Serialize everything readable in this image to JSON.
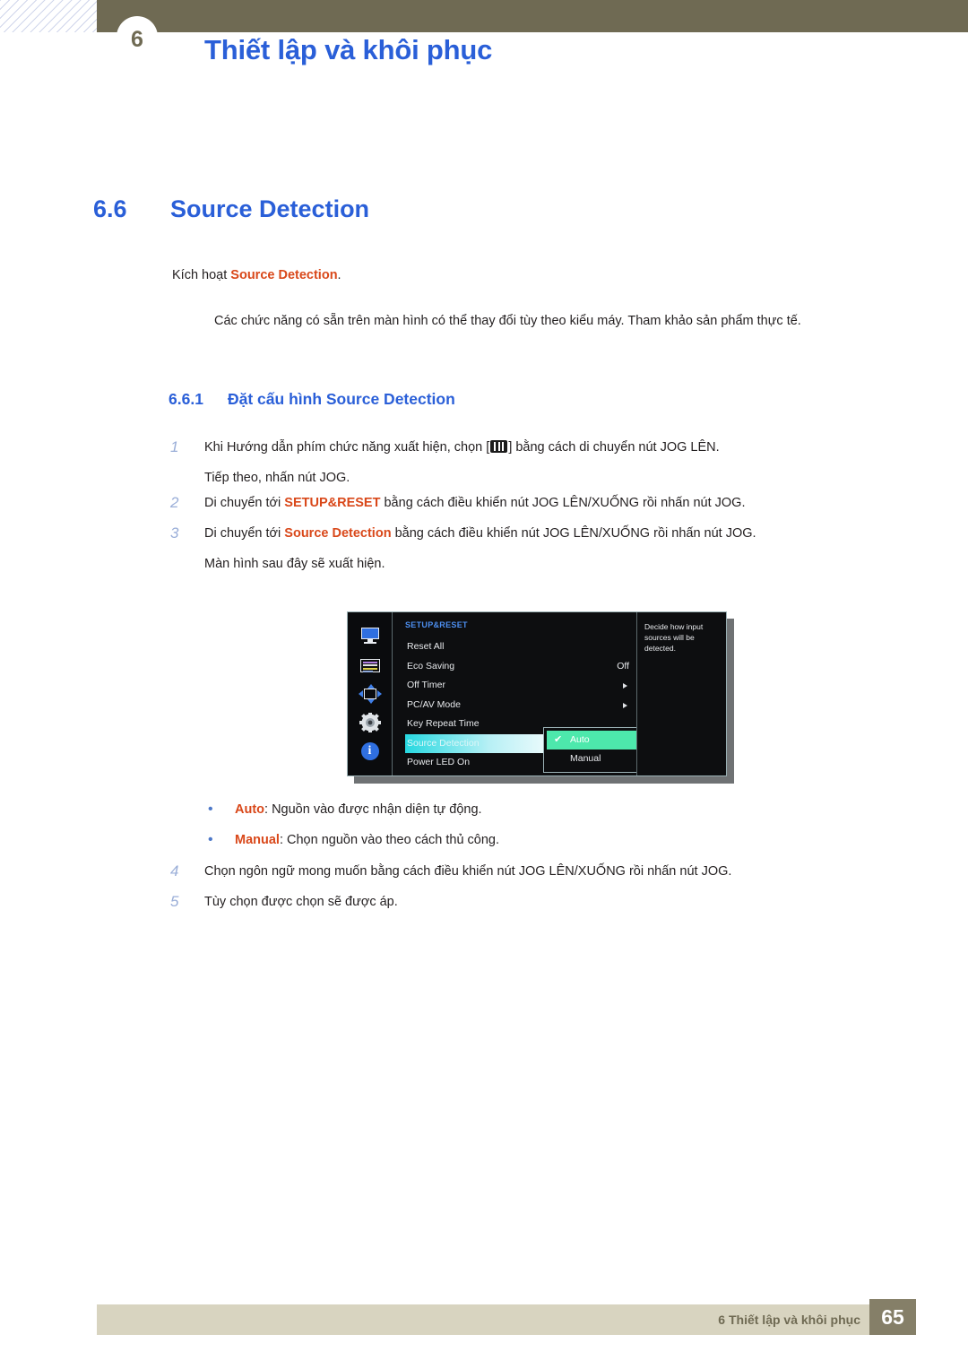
{
  "header": {
    "chapter_number": "6",
    "title": "Thiết lập và khôi phục"
  },
  "section": {
    "number": "6.6",
    "title": "Source Detection",
    "intro_prefix": "Kích hoạt ",
    "intro_highlight": "Source Detection",
    "intro_suffix": ".",
    "note": "Các chức năng có sẵn trên màn hình có thể thay đổi tùy theo kiểu máy. Tham khảo sản phẩm thực tế."
  },
  "subsection": {
    "number": "6.6.1",
    "title": "Đặt cấu hình Source Detection"
  },
  "steps": [
    {
      "num": "1",
      "text_before": "Khi Hướng dẫn phím chức năng xuất hiện, chọn [",
      "icon": "osd-menu-key-icon",
      "text_after": "] bằng cách di chuyển nút JOG LÊN.",
      "continuation": "Tiếp theo, nhấn nút JOG."
    },
    {
      "num": "2",
      "text_before": "Di chuyển tới ",
      "highlight": "SETUP&RESET",
      "text_after": " bằng cách điều khiển nút JOG LÊN/XUỐNG rồi nhấn nút JOG.",
      "continuation": ""
    },
    {
      "num": "3",
      "text_before": "Di chuyển tới ",
      "highlight": "Source Detection",
      "text_after": " bằng cách điều khiển nút JOG LÊN/XUỐNG rồi nhấn nút JOG.",
      "continuation": "Màn hình sau đây sẽ xuất hiện."
    },
    {
      "num": "4",
      "text_before": "Chọn ngôn ngữ mong muốn bằng cách điều khiển nút JOG LÊN/XUỐNG rồi nhấn nút JOG.",
      "highlight": "",
      "text_after": "",
      "continuation": ""
    },
    {
      "num": "5",
      "text_before": "Tùy chọn được chọn sẽ được áp.",
      "highlight": "",
      "text_after": "",
      "continuation": ""
    }
  ],
  "osd": {
    "menu_title": "SETUP&RESET",
    "sidebar_icons": [
      "monitor-icon",
      "color-bars-icon",
      "screen-adjust-icon",
      "gear-icon",
      "info-icon"
    ],
    "rows": [
      {
        "label": "Reset All",
        "value": "",
        "arrow": false,
        "selected": false
      },
      {
        "label": "Eco Saving",
        "value": "Off",
        "arrow": false,
        "selected": false
      },
      {
        "label": "Off Timer",
        "value": "",
        "arrow": true,
        "selected": false
      },
      {
        "label": "PC/AV Mode",
        "value": "",
        "arrow": true,
        "selected": false
      },
      {
        "label": "Key Repeat Time",
        "value": "",
        "arrow": false,
        "selected": false
      },
      {
        "label": "Source Detection",
        "value": "",
        "arrow": false,
        "selected": true
      },
      {
        "label": "Power LED On",
        "value": "",
        "arrow": false,
        "selected": false
      }
    ],
    "submenu": [
      {
        "label": "Auto",
        "checked": true,
        "check_glyph": "✔"
      },
      {
        "label": "Manual",
        "checked": false,
        "check_glyph": ""
      }
    ],
    "tooltip": "Decide how input sources will be detected.",
    "highlight_color": "#4de8ac",
    "title_color": "#4d8ff0"
  },
  "bullets": [
    {
      "marker": "•",
      "label": "Auto",
      "text": ": Nguồn vào được nhận diện tự động."
    },
    {
      "marker": "•",
      "label": "Manual",
      "text": ": Chọn nguồn vào theo cách thủ công."
    }
  ],
  "footer": {
    "text": "6 Thiết lập và khôi phục",
    "page": "65"
  },
  "colors": {
    "heading_blue": "#2a5fd8",
    "highlight_orange": "#d9481a",
    "header_olive": "#6f6a53",
    "footer_beige": "#d8d4c0",
    "footer_page_brown": "#857f68"
  }
}
